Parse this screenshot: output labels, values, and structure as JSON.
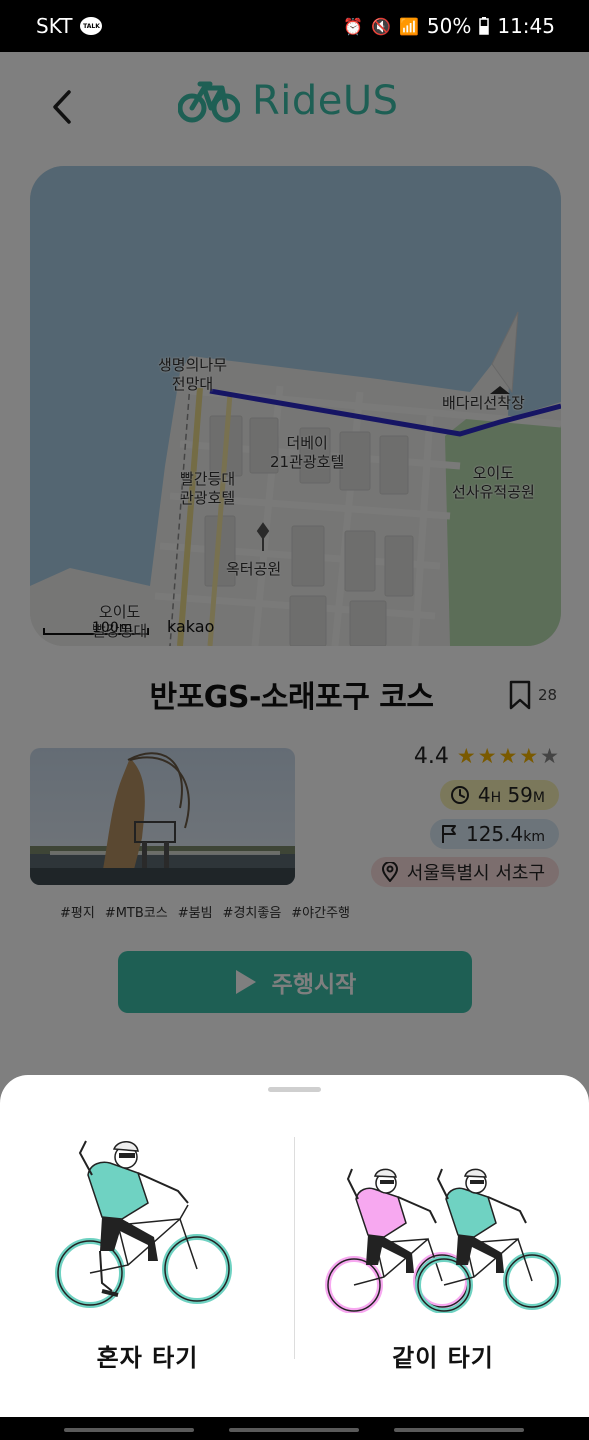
{
  "status_bar": {
    "carrier": "SKT",
    "talk_badge": "TALK",
    "battery": "50%",
    "time": "11:45"
  },
  "header": {
    "logo_text": "RideUS"
  },
  "map": {
    "labels": {
      "observatory": "생명의나무\n전망대",
      "pier": "배다리선착장",
      "hotel_the_bay": "더베이\n21관광호텔",
      "hotel_red_lighthouse": "빨간등대\n관광호텔",
      "park": "옥터공원",
      "historic_park": "오이도\n선사유적공원",
      "red_lighthouse": "오이도\n빨강등대"
    },
    "scale": "100m",
    "provider": "kakao"
  },
  "course": {
    "title": "반포GS-소래포구 코스",
    "bookmark_count": "28",
    "rating": "4.4",
    "stars": [
      1,
      1,
      1,
      1,
      0.4
    ],
    "duration_hours": "4",
    "duration_hours_unit": "H",
    "duration_minutes": "59",
    "duration_minutes_unit": "M",
    "distance_value": "125.4",
    "distance_unit": "km",
    "location": "서울특별시 서초구",
    "tags": [
      "#평지",
      "#MTB코스",
      "#붐빔",
      "#경치좋음",
      "#야간주행"
    ],
    "start_label": "주행시작"
  },
  "sheet": {
    "solo_label": "혼자 타기",
    "group_label": "같이 타기"
  },
  "colors": {
    "brand": "#3cbfa9",
    "route": "#2d2bc9",
    "star": "#f5b400",
    "time_badge": "#f6f0b6",
    "distance_badge": "#d9e8f5",
    "location_badge": "#f8dcdc",
    "rider_pink": "#f7a8f0"
  }
}
